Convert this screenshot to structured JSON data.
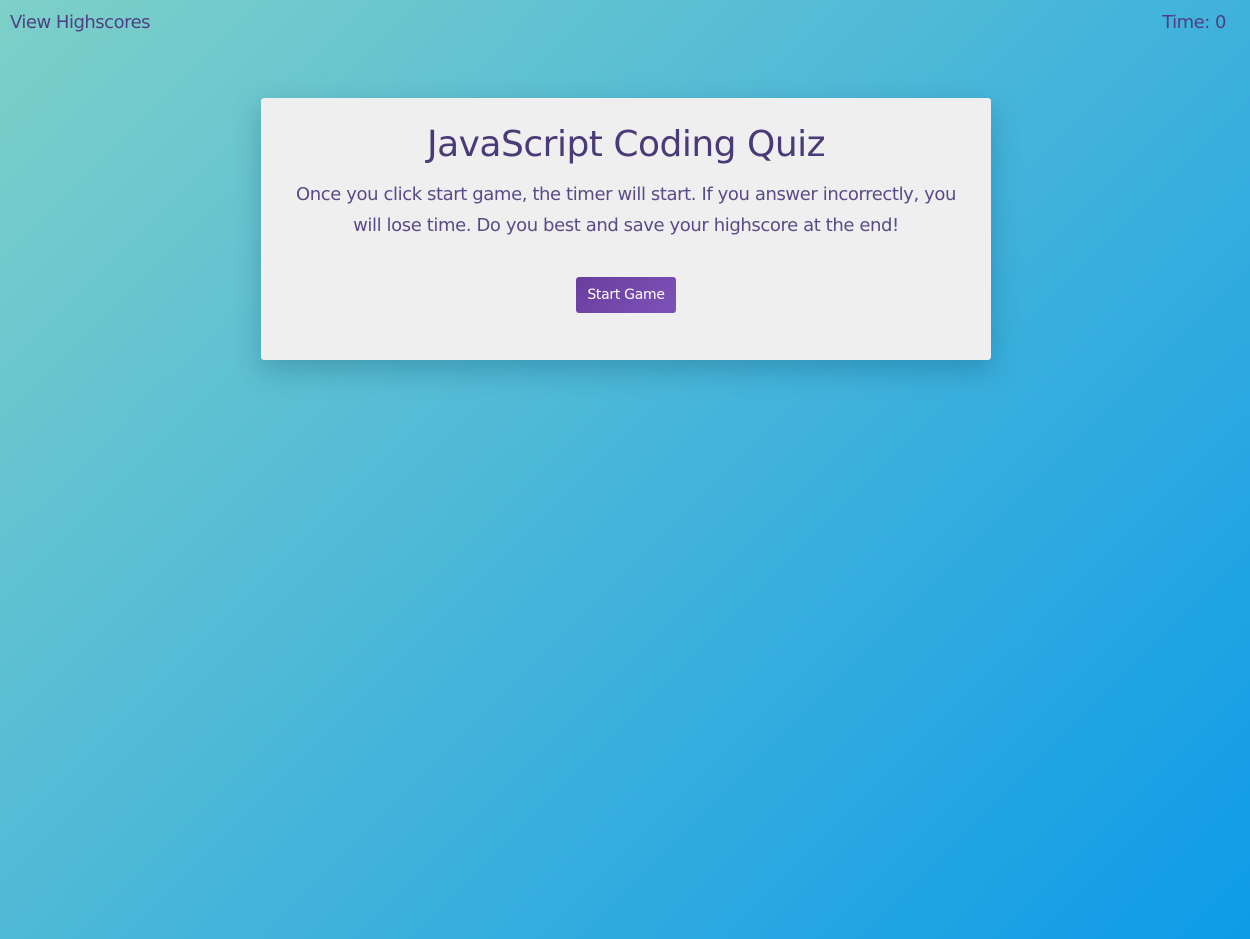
{
  "header": {
    "highscores_link": "View Highscores",
    "timer_text": "Time: 0"
  },
  "card": {
    "title": "JavaScript Coding Quiz",
    "instructions": "Once you click start game, the timer will start. If you answer incorrectly, you will lose time. Do you best and save your highscore at the end!",
    "start_button_label": "Start Game"
  },
  "colors": {
    "text_primary": "#4a3a78",
    "button_bg": "#6f45a8",
    "card_bg": "#efefef",
    "background_start": "#7ed0c8",
    "background_end": "#0d9be8"
  }
}
